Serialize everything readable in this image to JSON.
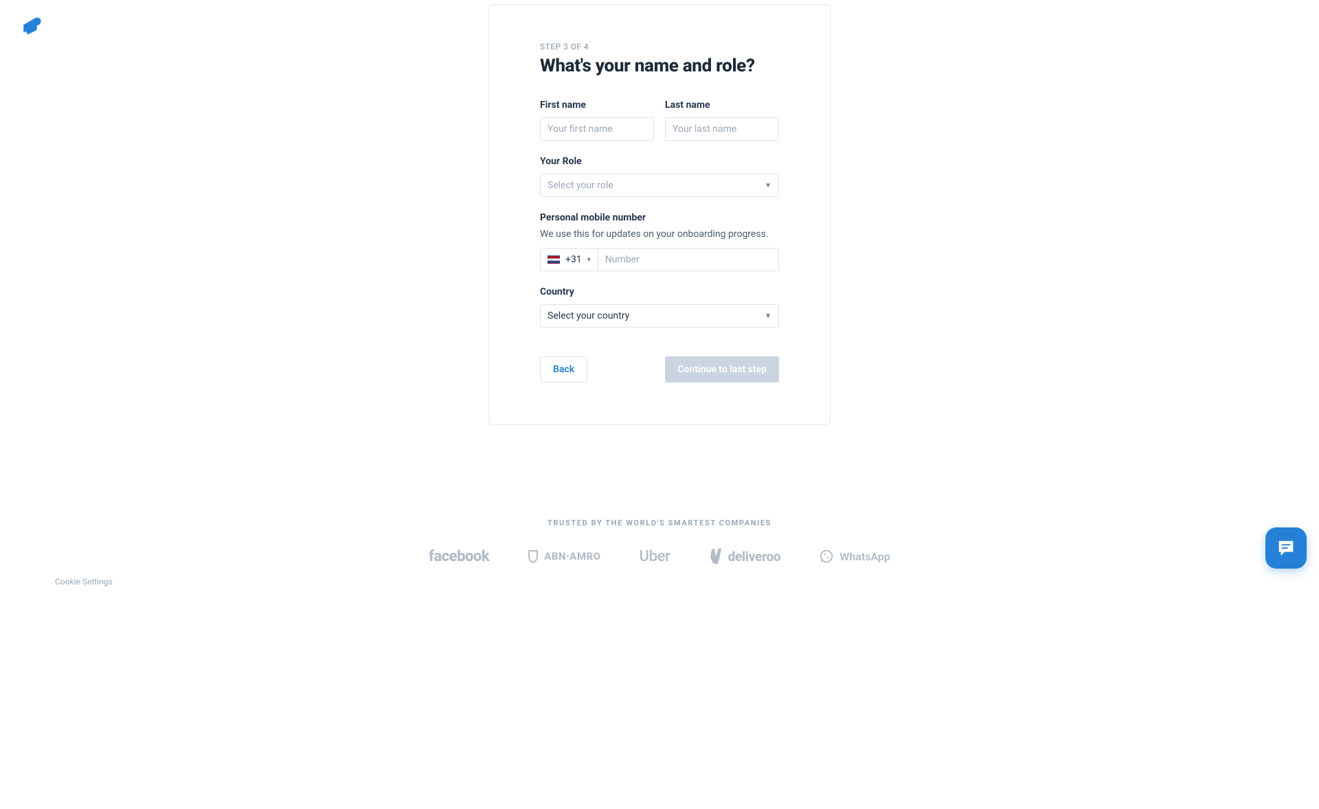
{
  "step_label": "STEP 3 OF 4",
  "heading": "What's your name and role?",
  "first_name": {
    "label": "First name",
    "placeholder": "Your first name"
  },
  "last_name": {
    "label": "Last name",
    "placeholder": "Your last name"
  },
  "role": {
    "label": "Your Role",
    "placeholder": "Select your role"
  },
  "phone": {
    "label": "Personal mobile number",
    "help": "We use this for updates on your onboarding progress.",
    "country_code": "+31",
    "placeholder": "Number"
  },
  "country": {
    "label": "Country",
    "placeholder": "Select your country"
  },
  "actions": {
    "back": "Back",
    "continue": "Continue to last step"
  },
  "trusted": {
    "label": "TRUSTED BY THE WORLD'S SMARTEST COMPANIES",
    "logos": {
      "facebook": "facebook",
      "abn": "ABN·AMRO",
      "uber": "Uber",
      "deliveroo": "deliveroo",
      "whatsapp": "WhatsApp"
    }
  },
  "cookie_settings": "Cookie Settings"
}
